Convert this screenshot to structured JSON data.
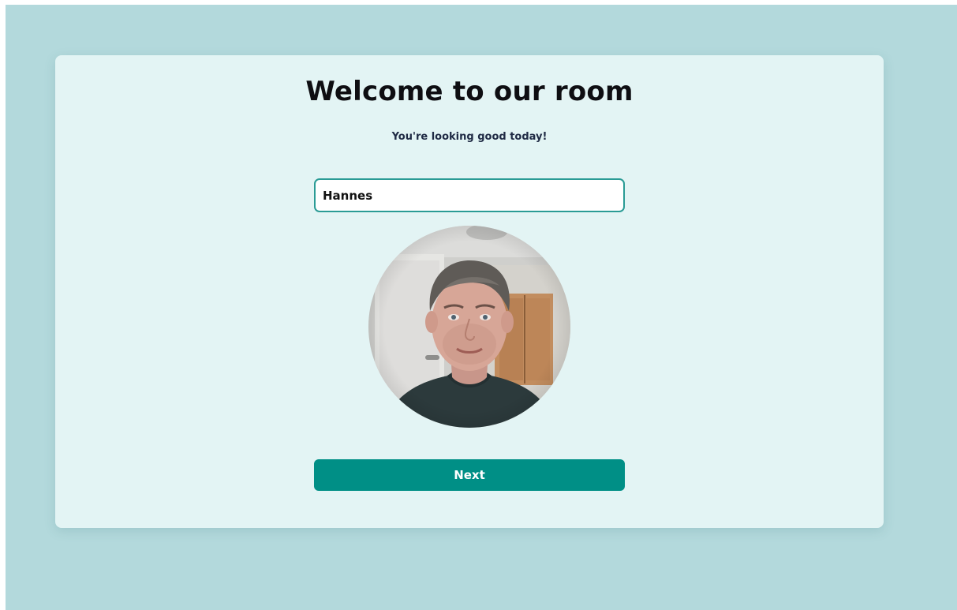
{
  "page": {
    "title": "Welcome to our room",
    "subtitle": "You're looking good today!"
  },
  "name_field": {
    "value": "Hannes"
  },
  "preview": {
    "icon": "camera-preview"
  },
  "actions": {
    "next_label": "Next"
  },
  "colors": {
    "background": "#b3d9dc",
    "card": "#e3f4f4",
    "accent": "#008f86",
    "input_border": "#2a9b95",
    "heading": "#0e0e12"
  }
}
